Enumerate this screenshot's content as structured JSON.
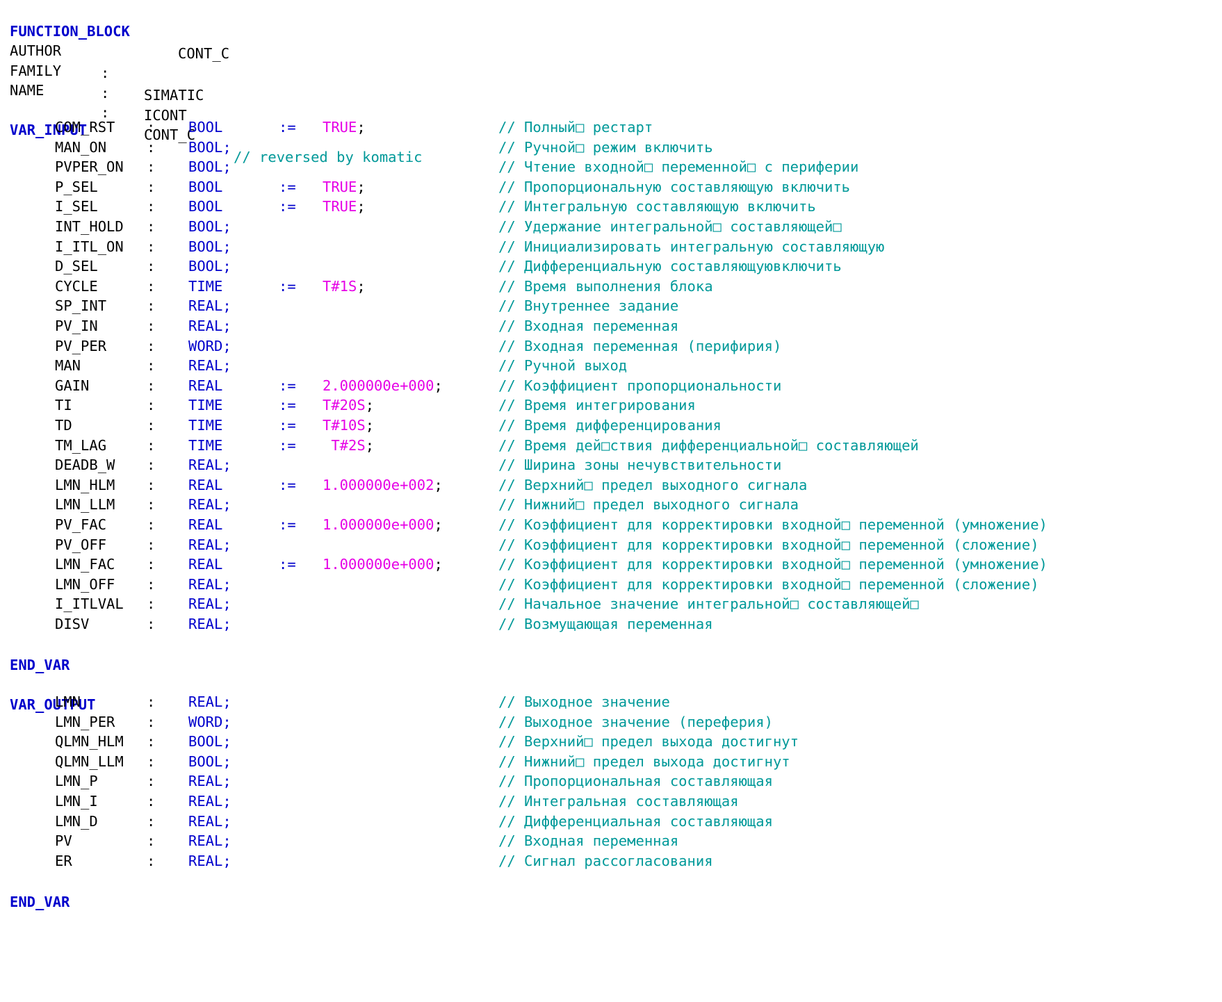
{
  "header": {
    "fb_keyword": "FUNCTION_BLOCK",
    "fb_name": "CONT_C",
    "attributes": [
      {
        "key": "AUTHOR",
        "colon": ":",
        "value": "SIMATIC",
        "comment": ""
      },
      {
        "key": "FAMILY",
        "colon": ":",
        "value": "ICONT",
        "comment": ""
      },
      {
        "key": "NAME",
        "colon": ":",
        "value": "CONT_C",
        "comment": "// reversed by komatic"
      }
    ]
  },
  "var_input": {
    "keyword": "VAR_INPUT",
    "end_keyword": "END_VAR",
    "vars": [
      {
        "name": "COM_RST",
        "colon": ":",
        "type": "BOOL",
        "assign": ":=",
        "init": "TRUE",
        "comment": "// Полный□ рестарт"
      },
      {
        "name": "MAN_ON",
        "colon": ":",
        "type": "BOOL;",
        "assign": "",
        "init": "",
        "comment": "// Ручной□ режим включить"
      },
      {
        "name": "PVPER_ON",
        "colon": ":",
        "type": "BOOL;",
        "assign": "",
        "init": "",
        "comment": "// Чтение входной□ переменной□ с периферии"
      },
      {
        "name": "P_SEL",
        "colon": ":",
        "type": "BOOL",
        "assign": ":=",
        "init": "TRUE",
        "comment": "// Пропорциональную составляющую включить"
      },
      {
        "name": "I_SEL",
        "colon": ":",
        "type": "BOOL",
        "assign": ":=",
        "init": "TRUE",
        "comment": "// Интегральную составляющую включить"
      },
      {
        "name": "INT_HOLD",
        "colon": ":",
        "type": "BOOL;",
        "assign": "",
        "init": "",
        "comment": "// Удержание интегральной□ составляющей□"
      },
      {
        "name": "I_ITL_ON",
        "colon": ":",
        "type": "BOOL;",
        "assign": "",
        "init": "",
        "comment": "// Инициализировать интегральную составляющую"
      },
      {
        "name": "D_SEL",
        "colon": ":",
        "type": "BOOL;",
        "assign": "",
        "init": "",
        "comment": "// Дифференциальную составляющуювключить"
      },
      {
        "name": "CYCLE",
        "colon": ":",
        "type": "TIME",
        "assign": ":=",
        "init": "T#1S",
        "comment": "// Время выполнения блока"
      },
      {
        "name": "SP_INT",
        "colon": ":",
        "type": "REAL;",
        "assign": "",
        "init": "",
        "comment": "// Внутреннее задание"
      },
      {
        "name": "PV_IN",
        "colon": ":",
        "type": "REAL;",
        "assign": "",
        "init": "",
        "comment": "// Входная переменная"
      },
      {
        "name": "PV_PER",
        "colon": ":",
        "type": "WORD;",
        "assign": "",
        "init": "",
        "comment": "// Входная переменная (перифирия)"
      },
      {
        "name": "MAN",
        "colon": ":",
        "type": "REAL;",
        "assign": "",
        "init": "",
        "comment": "// Ручной выход"
      },
      {
        "name": "GAIN",
        "colon": ":",
        "type": "REAL",
        "assign": ":=",
        "init": "2.000000e+000",
        "comment": "// Коэффициент пропорциональности"
      },
      {
        "name": "TI",
        "colon": ":",
        "type": "TIME",
        "assign": ":=",
        "init": "T#20S",
        "comment": "// Время интегрирования"
      },
      {
        "name": "TD",
        "colon": ":",
        "type": "TIME",
        "assign": ":=",
        "init": "T#10S",
        "comment": "// Время дифференцирования"
      },
      {
        "name": "TM_LAG",
        "colon": ":",
        "type": "TIME",
        "assign": ":=",
        "init": " T#2S",
        "comment": "// Время дей□ствия дифференциальной□ составляющей"
      },
      {
        "name": "DEADB_W",
        "colon": ":",
        "type": "REAL;",
        "assign": "",
        "init": "",
        "comment": "// Ширина зоны нечувствительности"
      },
      {
        "name": "LMN_HLM",
        "colon": ":",
        "type": "REAL",
        "assign": ":=",
        "init": "1.000000e+002",
        "comment": "// Верхний□ предел выходного сигнала"
      },
      {
        "name": "LMN_LLM",
        "colon": ":",
        "type": "REAL;",
        "assign": "",
        "init": "",
        "comment": "// Нижний□ предел выходного сигнала"
      },
      {
        "name": "PV_FAC",
        "colon": ":",
        "type": "REAL",
        "assign": ":=",
        "init": "1.000000e+000",
        "comment": "// Коэффициент для корректировки входной□ переменной (умножение)"
      },
      {
        "name": "PV_OFF",
        "colon": ":",
        "type": "REAL;",
        "assign": "",
        "init": "",
        "comment": "// Коэффициент для корректировки входной□ переменной (сложение)"
      },
      {
        "name": "LMN_FAC",
        "colon": ":",
        "type": "REAL",
        "assign": ":=",
        "init": "1.000000e+000",
        "comment": "// Коэффициент для корректировки входной□ переменной (умножение)"
      },
      {
        "name": "LMN_OFF",
        "colon": ":",
        "type": "REAL;",
        "assign": "",
        "init": "",
        "comment": "// Коэффициент для корректировки входной□ переменной (сложение)"
      },
      {
        "name": "I_ITLVAL",
        "colon": ":",
        "type": "REAL;",
        "assign": "",
        "init": "",
        "comment": "// Начальное значение интегральной□ составляющей□"
      },
      {
        "name": "DISV",
        "colon": ":",
        "type": "REAL;",
        "assign": "",
        "init": "",
        "comment": "// Возмущающая переменная"
      }
    ]
  },
  "var_output": {
    "keyword": "VAR_OUTPUT",
    "end_keyword": "END_VAR",
    "vars": [
      {
        "name": "LMN",
        "colon": ":",
        "type": "REAL;",
        "comment": "// Выходное значение"
      },
      {
        "name": "LMN_PER",
        "colon": ":",
        "type": "WORD;",
        "comment": "// Выходное значение (переферия)"
      },
      {
        "name": "QLMN_HLM",
        "colon": ":",
        "type": "BOOL;",
        "comment": "// Верхний□ предел выхода достигнут"
      },
      {
        "name": "QLMN_LLM",
        "colon": ":",
        "type": "BOOL;",
        "comment": "// Нижний□ предел выхода достигнут"
      },
      {
        "name": "LMN_P",
        "colon": ":",
        "type": "REAL;",
        "comment": "// Пропорциональная составляющая"
      },
      {
        "name": "LMN_I",
        "colon": ":",
        "type": "REAL;",
        "comment": "// Интегральная составляющая"
      },
      {
        "name": "LMN_D",
        "colon": ":",
        "type": "REAL;",
        "comment": "// Дифференциальная составляющая"
      },
      {
        "name": "PV",
        "colon": ":",
        "type": "REAL;",
        "comment": "// Входная переменная"
      },
      {
        "name": "ER",
        "colon": ":",
        "type": "REAL;",
        "comment": "// Сигнал рассогласования"
      }
    ]
  },
  "colors": {
    "keyword": "#0000cc",
    "literal": "#e600e6",
    "comment": "#009999",
    "text": "#000000",
    "background": "#ffffff"
  }
}
